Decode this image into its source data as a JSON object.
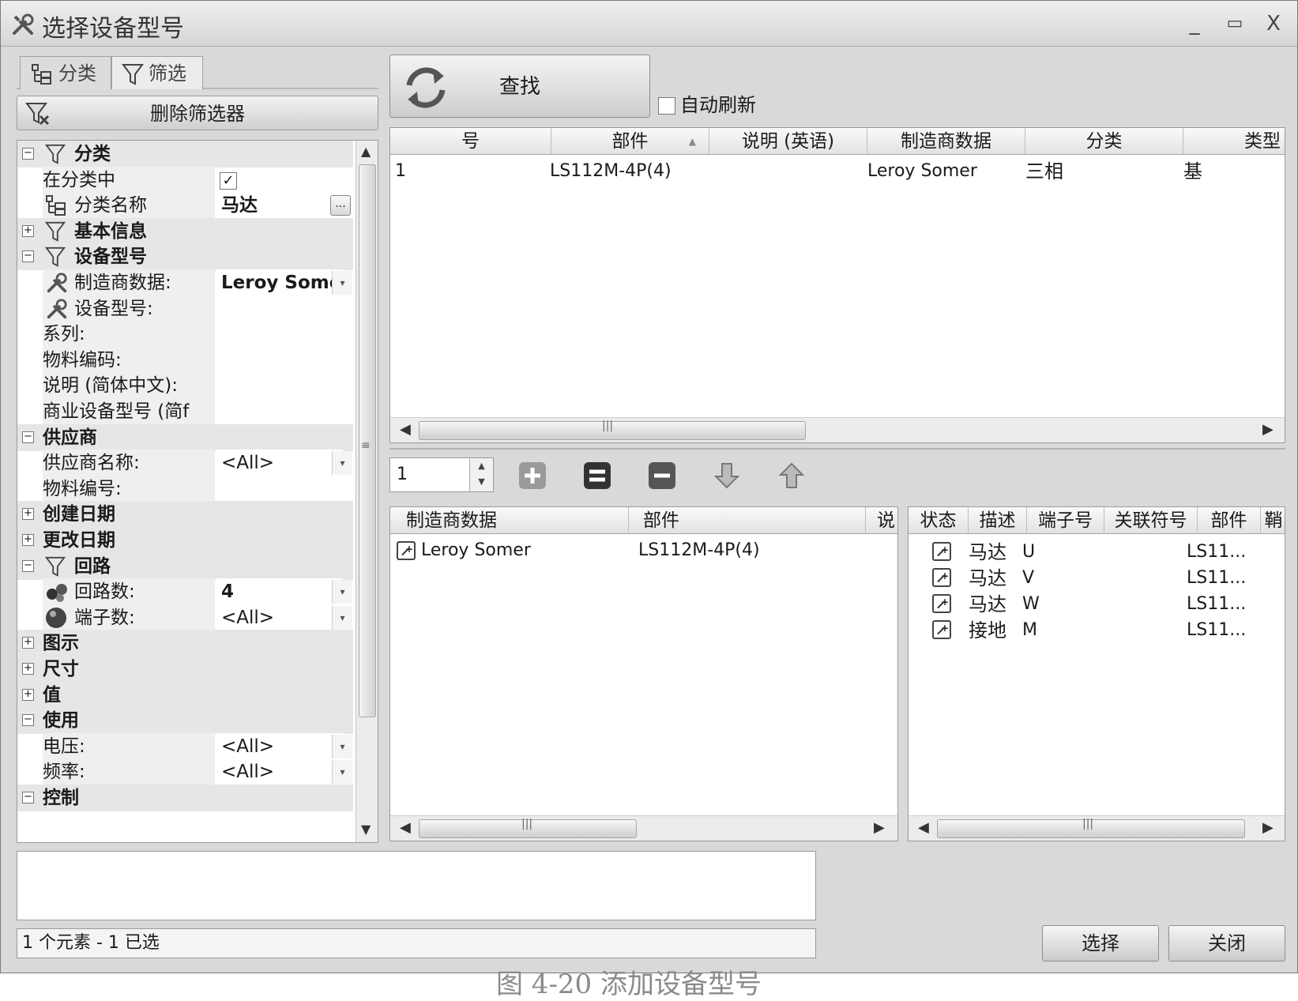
{
  "window": {
    "title": "选择设备型号",
    "minimize": "_",
    "maximize": "▭",
    "close": "X"
  },
  "left": {
    "tabs": [
      {
        "label": "分类",
        "icon": "tree-icon"
      },
      {
        "label": "筛选",
        "icon": "filter-icon"
      }
    ],
    "delete_filter_label": "删除筛选器",
    "property_grid": {
      "rows": [
        {
          "type": "category",
          "expander": "⊟",
          "label": "分类",
          "filter_icon": true
        },
        {
          "type": "prop",
          "label": "在分类中",
          "checkbox": "✓"
        },
        {
          "type": "prop",
          "label": "分类名称",
          "value": "马达",
          "value_bold": true,
          "ellipsis": "...",
          "icon": "tree-icon"
        },
        {
          "type": "category",
          "expander": "⊞",
          "label": "基本信息",
          "filter_icon": true
        },
        {
          "type": "category",
          "expander": "⊟",
          "label": "设备型号",
          "filter_icon": true
        },
        {
          "type": "prop",
          "label": "制造商数据:",
          "value": "Leroy Somer",
          "value_bold": true,
          "dropdown": "▾",
          "icon": "tools-icon"
        },
        {
          "type": "prop",
          "label": "设备型号:",
          "value": "",
          "icon": "tools-icon"
        },
        {
          "type": "prop",
          "label": "系列:",
          "value": ""
        },
        {
          "type": "prop",
          "label": "物料编码:",
          "value": ""
        },
        {
          "type": "prop",
          "label": "说明 (简体中文):",
          "value": ""
        },
        {
          "type": "prop",
          "label": "商业设备型号 (简f",
          "value": ""
        },
        {
          "type": "category",
          "expander": "⊟",
          "label": "供应商"
        },
        {
          "type": "prop",
          "label": "供应商名称:",
          "value": "<All>",
          "dropdown": "▾"
        },
        {
          "type": "prop",
          "label": "物料编号:",
          "value": ""
        },
        {
          "type": "category",
          "expander": "⊞",
          "label": "创建日期"
        },
        {
          "type": "category",
          "expander": "⊞",
          "label": "更改日期"
        },
        {
          "type": "category",
          "expander": "⊟",
          "label": "回路",
          "filter_icon": true
        },
        {
          "type": "prop",
          "label": "回路数:",
          "value": "4",
          "value_bold": true,
          "dropdown": "▾",
          "icon": "circuit-icon"
        },
        {
          "type": "prop",
          "label": "端子数:",
          "value": "<All>",
          "dropdown": "▾",
          "icon": "sphere-icon"
        },
        {
          "type": "category",
          "expander": "⊞",
          "label": "图示"
        },
        {
          "type": "category",
          "expander": "⊞",
          "label": "尺寸"
        },
        {
          "type": "category",
          "expander": "⊞",
          "label": "值"
        },
        {
          "type": "category",
          "expander": "⊟",
          "label": "使用"
        },
        {
          "type": "prop",
          "label": "电压:",
          "value": "<All>",
          "dropdown": "▾"
        },
        {
          "type": "prop",
          "label": "频率:",
          "value": "<All>",
          "dropdown": "▾"
        },
        {
          "type": "category",
          "expander": "⊟",
          "label": "控制"
        }
      ]
    },
    "scroll_up": "▲",
    "scroll_down": "▼",
    "scroll_grip": "≡"
  },
  "right": {
    "find_label": "查找",
    "auto_refresh_label": "自动刷新",
    "results": {
      "columns": [
        "号",
        "部件",
        "说明 (英语)",
        "制造商数据",
        "分类",
        "类型"
      ],
      "sort_indicator": "▲",
      "rows": [
        [
          "1",
          "LS112M-4P(4)",
          "",
          "Leroy Somer",
          "三相",
          "基"
        ]
      ]
    },
    "quantity_value": "1",
    "spin_up": "▲",
    "spin_down": "▼",
    "parts": {
      "columns": [
        "制造商数据",
        "部件",
        "说"
      ],
      "rows": [
        [
          "Leroy Somer",
          "LS112M-4P(4)"
        ]
      ]
    },
    "terminals": {
      "columns": [
        "状态",
        "描述",
        "端子号",
        "关联符号",
        "部件",
        "鞘"
      ],
      "rows": [
        [
          "马达",
          "U",
          "",
          "LS11..."
        ],
        [
          "马达",
          "V",
          "",
          "LS11..."
        ],
        [
          "马达",
          "W",
          "",
          "LS11..."
        ],
        [
          "接地",
          "M",
          "",
          "LS11..."
        ]
      ]
    },
    "scroll_left": "◀",
    "scroll_right": "▶",
    "scroll_grip": "|||"
  },
  "status_text": "1 个元素 - 1 已选",
  "buttons": {
    "select": "选择",
    "close": "关闭"
  },
  "caption": "图 4-20  添加设备型号"
}
